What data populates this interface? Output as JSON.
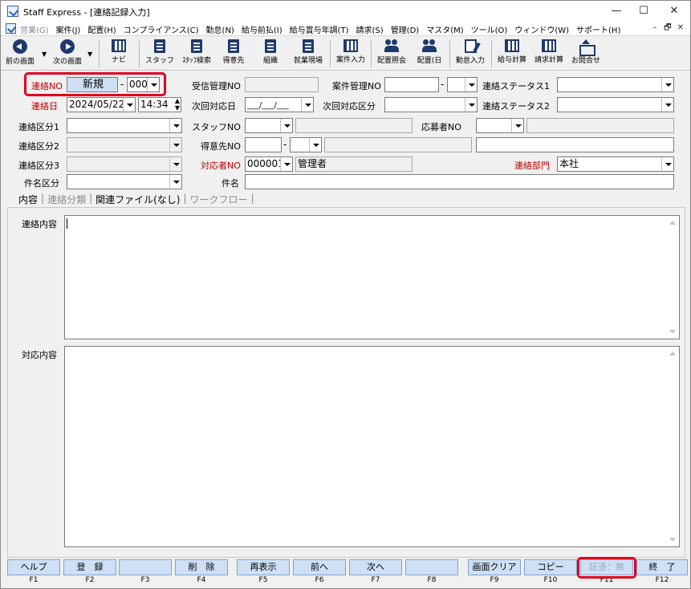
{
  "window": {
    "title": "Staff Express - [連絡記録入力]",
    "controls": {
      "minimize": "—",
      "maximize": "☐",
      "close": "✕"
    }
  },
  "menu": {
    "items": [
      {
        "label": "営業(G)",
        "disabled": true
      },
      {
        "label": "案件(J)"
      },
      {
        "label": "配置(H)"
      },
      {
        "label": "コンプライアンス(C)"
      },
      {
        "label": "勤怠(N)"
      },
      {
        "label": "給与前払(I)"
      },
      {
        "label": "給与賞与年調(T)"
      },
      {
        "label": "請求(S)"
      },
      {
        "label": "管理(D)"
      },
      {
        "label": "マスタ(M)"
      },
      {
        "label": "ツール(O)"
      },
      {
        "label": "ウィンドウ(W)"
      },
      {
        "label": "サポート(H)"
      }
    ],
    "mdi": {
      "minimize": "–",
      "restore": "🗗",
      "close": "✕"
    }
  },
  "toolbar": {
    "buttons": [
      {
        "label": "前の画面",
        "icon": "back-arrow-icon"
      },
      {
        "label": "次の画面",
        "icon": "forward-arrow-icon"
      },
      {
        "label": "ナビ",
        "icon": "navi-icon"
      },
      {
        "label": "スタッフ",
        "icon": "staff-icon"
      },
      {
        "label": "ｽﾀｯﾌ検索",
        "icon": "staff-search-icon"
      },
      {
        "label": "得意先",
        "icon": "customer-icon"
      },
      {
        "label": "組織",
        "icon": "organization-icon"
      },
      {
        "label": "就業現場",
        "icon": "worksite-icon"
      },
      {
        "label": "案件入力",
        "icon": "case-input-icon"
      },
      {
        "label": "配置照会",
        "icon": "placement-inquiry-icon"
      },
      {
        "label": "配置(日",
        "icon": "placement-daily-icon"
      },
      {
        "label": "勤怠入力",
        "icon": "attendance-input-icon"
      },
      {
        "label": "給与計算",
        "icon": "payroll-icon"
      },
      {
        "label": "請求計算",
        "icon": "billing-icon"
      },
      {
        "label": "お問合せ",
        "icon": "inquiry-icon"
      }
    ]
  },
  "form": {
    "renraku_no": {
      "label": "連絡NO",
      "value": "新規",
      "sub": "000"
    },
    "jushin_kanri_no": {
      "label": "受信管理NO",
      "value": ""
    },
    "anken_kanri_no": {
      "label": "案件管理NO",
      "value": "",
      "sep": "-"
    },
    "status1": {
      "label": "連絡ステータス1",
      "value": ""
    },
    "renraku_bi": {
      "label": "連絡日",
      "date": "2024/05/22",
      "time": "14:34"
    },
    "jikai_taiou_bi": {
      "label": "次回対応日",
      "value": "___/___/___"
    },
    "jikai_taiou_kubun": {
      "label": "次回対応区分",
      "value": ""
    },
    "status2": {
      "label": "連絡ステータス2",
      "value": ""
    },
    "kubun1": {
      "label": "連絡区分1",
      "value": ""
    },
    "staff_no": {
      "label": "スタッフNO",
      "value": ""
    },
    "oubosha_no": {
      "label": "応募者NO",
      "value": ""
    },
    "kubun2": {
      "label": "連絡区分2",
      "value": ""
    },
    "tokuisaki_no": {
      "label": "得意先NO",
      "value": "",
      "sep": "-"
    },
    "kubun3": {
      "label": "連絡区分3",
      "value": ""
    },
    "taiousha_no": {
      "label": "対応者NO",
      "value": "000001",
      "name": "管理者"
    },
    "renraku_bumon": {
      "label": "連絡部門",
      "value": "本社"
    },
    "kenmei_kubun": {
      "label": "件名区分",
      "value": ""
    },
    "kenmei": {
      "label": "件名",
      "value": ""
    }
  },
  "tabs": [
    {
      "label": "内容",
      "active": true
    },
    {
      "label": "連絡分類",
      "active": false
    },
    {
      "label": "関連ファイル(なし)",
      "active": true
    },
    {
      "label": "ワークフロー",
      "active": false
    }
  ],
  "content": {
    "renraku_naiyou_label": "連絡内容",
    "taiou_naiyou_label": "対応内容"
  },
  "fkeys": [
    {
      "label": "ヘルプ",
      "key": "F1"
    },
    {
      "label": "登　録",
      "key": "F2"
    },
    {
      "label": "",
      "key": "F3"
    },
    {
      "label": "削　除",
      "key": "F4"
    },
    {
      "label": "再表示",
      "key": "F5"
    },
    {
      "label": "前へ",
      "key": "F6"
    },
    {
      "label": "次へ",
      "key": "F7"
    },
    {
      "label": "",
      "key": "F8"
    },
    {
      "label": "画面クリア",
      "key": "F9"
    },
    {
      "label": "コピー",
      "key": "F10"
    },
    {
      "label": "証憑：無",
      "key": "F11",
      "disabled": true
    },
    {
      "label": "終　了",
      "key": "F12"
    }
  ],
  "colors": {
    "label_red": "#c00000",
    "highlight": "#e0001b",
    "fkey_bg": "#cfe0f5",
    "new_bg": "#cfe0f5"
  }
}
